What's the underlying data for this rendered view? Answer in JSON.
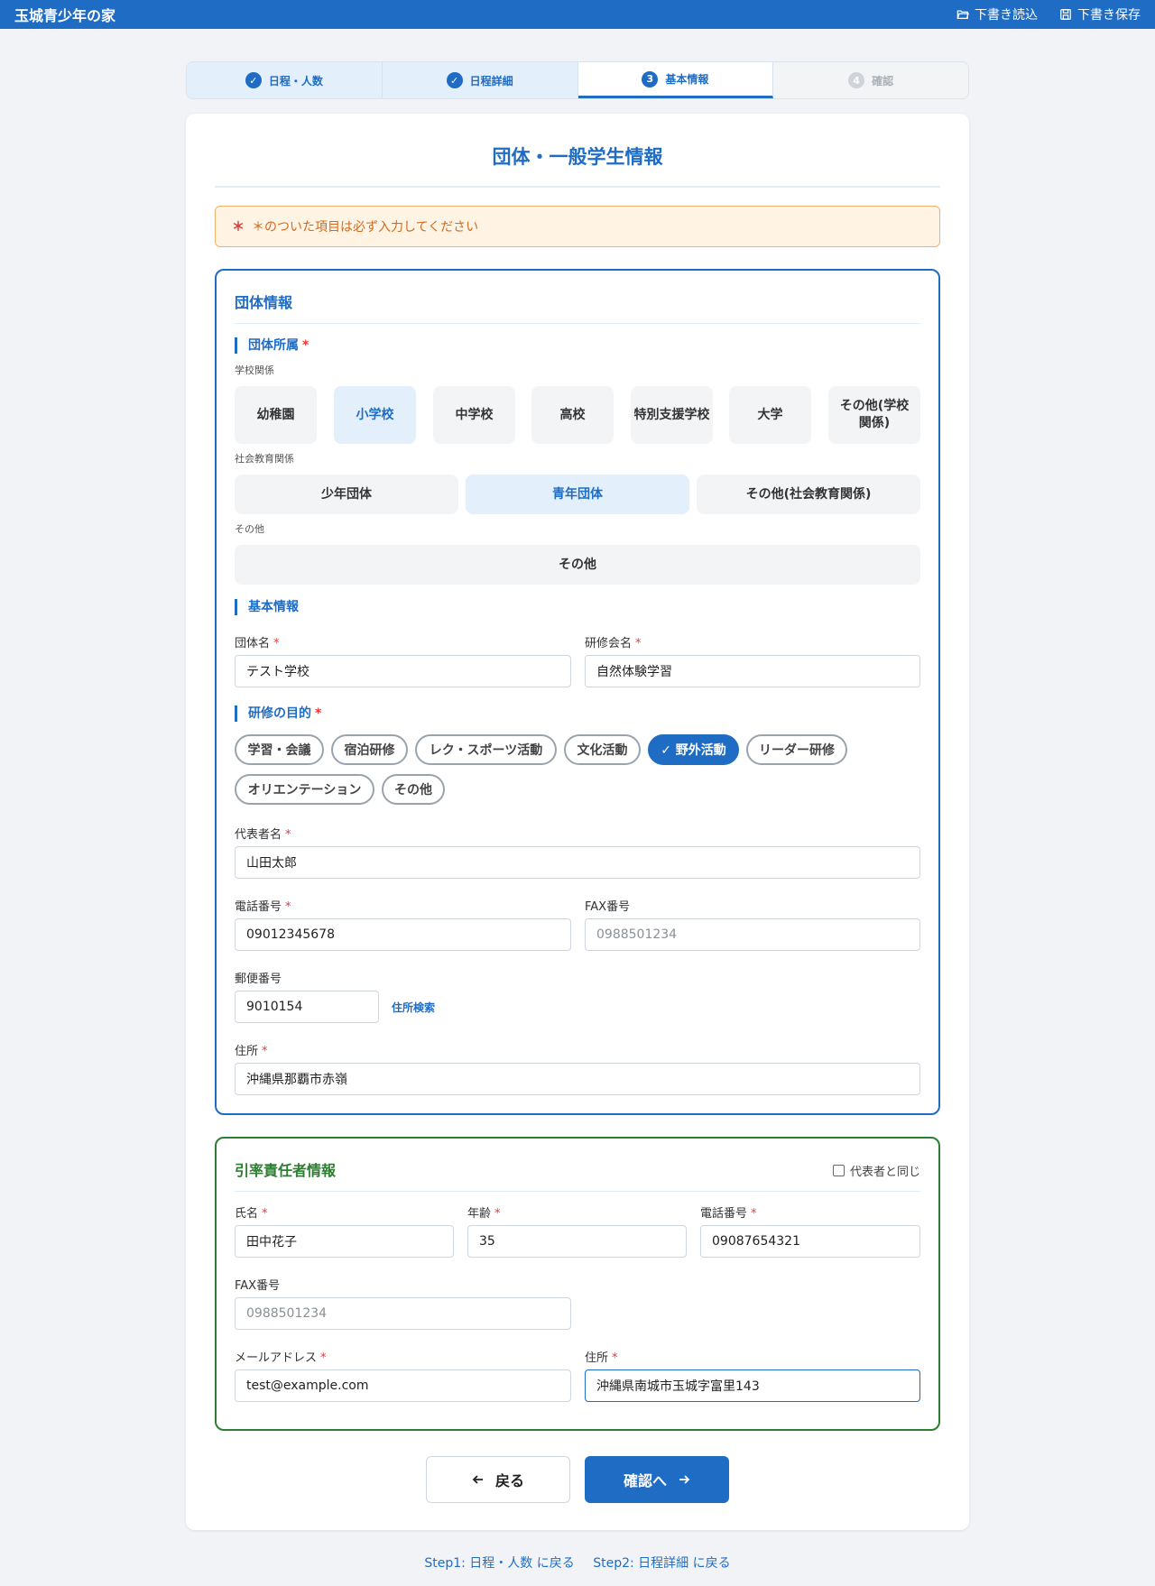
{
  "app": {
    "title": "玉城青少年の家"
  },
  "topbar": {
    "load_label": "下書き読込",
    "save_label": "下書き保存"
  },
  "steps": [
    {
      "badge": "✓",
      "label": "日程・人数"
    },
    {
      "badge": "✓",
      "label": "日程詳細"
    },
    {
      "badge": "3",
      "label": "基本情報"
    },
    {
      "badge": "4",
      "label": "確認"
    }
  ],
  "page": {
    "title": "団体・一般学生情報",
    "notice": "＊のついた項目は必ず入力してください",
    "notice_mark": "＊"
  },
  "org_section": {
    "title": "団体情報",
    "affiliation": {
      "heading": "団体所属",
      "school_label": "学校関係",
      "school_options": [
        "幼稚園",
        "小学校",
        "中学校",
        "高校",
        "特別支援学校",
        "大学",
        "その他(学校関係)"
      ],
      "social_label": "社会教育関係",
      "social_options": [
        "少年団体",
        "青年団体",
        "その他(社会教育関係)"
      ],
      "other_label": "その他",
      "other_options": [
        "その他"
      ]
    },
    "basic": {
      "heading": "基本情報",
      "org_name_label": "団体名",
      "org_name_value": "テスト学校",
      "training_name_label": "研修会名",
      "training_name_value": "自然体験学習"
    },
    "purpose": {
      "heading": "研修の目的",
      "chips": [
        "学習・会議",
        "宿泊研修",
        "レク・スポーツ活動",
        "文化活動",
        "✓ 野外活動",
        "リーダー研修",
        "オリエンテーション",
        "その他"
      ]
    },
    "rep_name_label": "代表者名",
    "rep_name_value": "山田太郎",
    "phone_label": "電話番号",
    "phone_value": "09012345678",
    "fax_label": "FAX番号",
    "fax_placeholder": "0988501234",
    "postal_label": "郵便番号",
    "postal_value": "9010154",
    "address_search": "住所検索",
    "address_label": "住所",
    "address_value": "沖縄県那覇市赤嶺"
  },
  "leader_section": {
    "title": "引率責任者情報",
    "same_as_rep": "代表者と同じ",
    "name_label": "氏名",
    "name_value": "田中花子",
    "age_label": "年齢",
    "age_value": "35",
    "phone_label": "電話番号",
    "phone_value": "09087654321",
    "fax_label": "FAX番号",
    "fax_placeholder": "0988501234",
    "email_label": "メールアドレス",
    "email_value": "test@example.com",
    "address_label": "住所",
    "address_value": "沖縄県南城市玉城字富里143"
  },
  "actions": {
    "back": "戻る",
    "next": "確認へ"
  },
  "footer": {
    "step1_link": "Step1: 日程・人数 に戻る",
    "step2_link": "Step2: 日程詳細 に戻る"
  },
  "colors": {
    "primary": "#1f6cc4",
    "leader_border": "#2e7d32",
    "notice_bg": "#fff4e3",
    "required": "#e53935"
  }
}
